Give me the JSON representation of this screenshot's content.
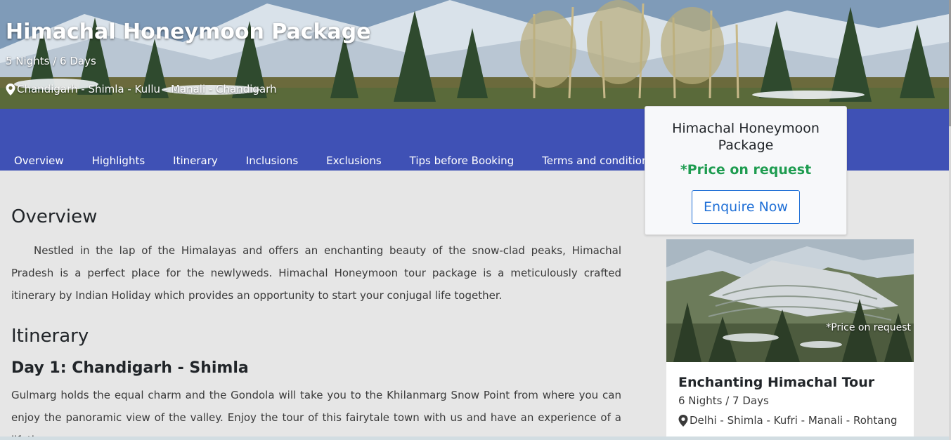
{
  "hero": {
    "title": "Himachal Honeymoon Package",
    "duration": "5 Nights / 6 Days",
    "route": "Chandigarh - Shimla - Kullu - Manali - Chandigarh"
  },
  "nav": {
    "tabs": [
      {
        "label": "Overview"
      },
      {
        "label": "Highlights"
      },
      {
        "label": "Itinerary"
      },
      {
        "label": "Inclusions"
      },
      {
        "label": "Exclusions"
      },
      {
        "label": "Tips before Booking"
      },
      {
        "label": "Terms and conditions"
      }
    ]
  },
  "price_card": {
    "title": "Himachal Honeymoon Package",
    "price": "*Price on request",
    "enquire_label": "Enquire Now"
  },
  "overview": {
    "heading": "Overview",
    "text": "Nestled in the lap of the Himalayas and offers an enchanting beauty of the snow-clad peaks, Himachal Pradesh is a perfect place for the newlyweds. Himachal Honeymoon tour package is a meticulously crafted itinerary by Indian Holiday which provides an opportunity to start your conjugal life together."
  },
  "itinerary": {
    "heading": "Itinerary",
    "days": [
      {
        "title": "Day 1: Chandigarh - Shimla",
        "text": "Gulmarg holds the equal charm and the Gondola will take you to the Khilanmarg Snow Point from where you can enjoy the panoramic view of the valley. Enjoy the tour of this fairytale town with us and have an experience of a lifetime."
      }
    ]
  },
  "tour_card": {
    "price_overlay": "*Price on request",
    "title": "Enchanting Himachal Tour",
    "duration": "6 Nights / 7 Days",
    "route": "Delhi - Shimla - Kufri - Manali - Rohtang"
  },
  "colors": {
    "nav_bg": "#3f51b5",
    "price_green": "#1e9c50",
    "button_blue": "#1f6fd6",
    "page_bg": "#e6e6e6"
  },
  "icons": {
    "location": "map-pin-icon"
  }
}
